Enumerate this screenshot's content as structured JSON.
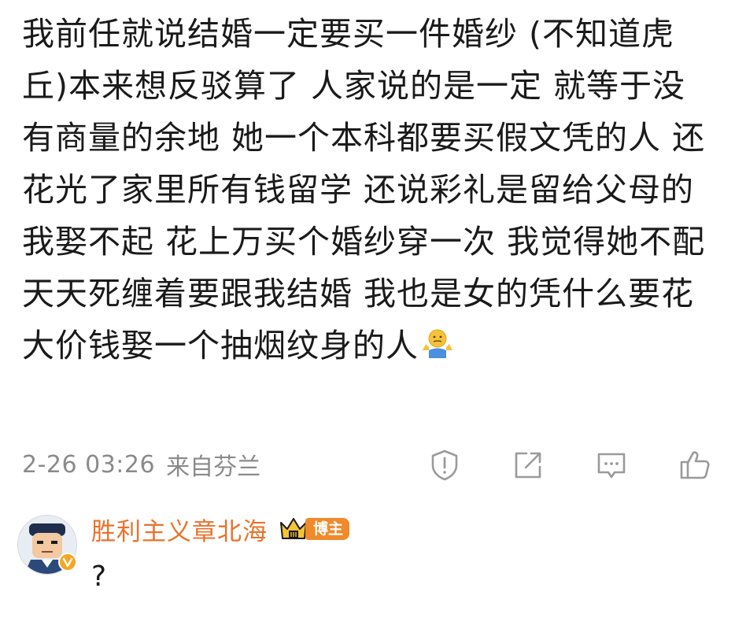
{
  "post": {
    "text": "我前任就说结婚一定要买一件婚纱 (不知道虎丘)本来想反驳算了 人家说的是一定 就等于没有商量的余地 她一个本科都要买假文凭的人 还花光了家里所有钱留学 还说彩礼是留给父母的 我娶不起 花上万买个婚纱穿一次 我觉得她不配 天天死缠着要跟我结婚 我也是女的凭什么要花大价钱娶一个抽烟纹身的人",
    "emoji": "shrug-emoji"
  },
  "meta": {
    "time": "2-26 03:26",
    "location": "来自芬兰"
  },
  "actions": [
    {
      "icon": "report-icon"
    },
    {
      "icon": "forward-icon"
    },
    {
      "icon": "comment-icon"
    },
    {
      "icon": "like-icon"
    }
  ],
  "reply": {
    "name": "胜利主义章北海",
    "badge": "博主",
    "text": "?",
    "avatar_icon": "avatar-cartoon-face",
    "crown_icon": "crown-icon",
    "verify_icon": "verified-badge-icon"
  },
  "colors": {
    "text": "#1a1a1a",
    "meta": "#8a8a8a",
    "name": "#e8722c",
    "badge": "#f08a2b",
    "icon": "#9a9a9a"
  }
}
